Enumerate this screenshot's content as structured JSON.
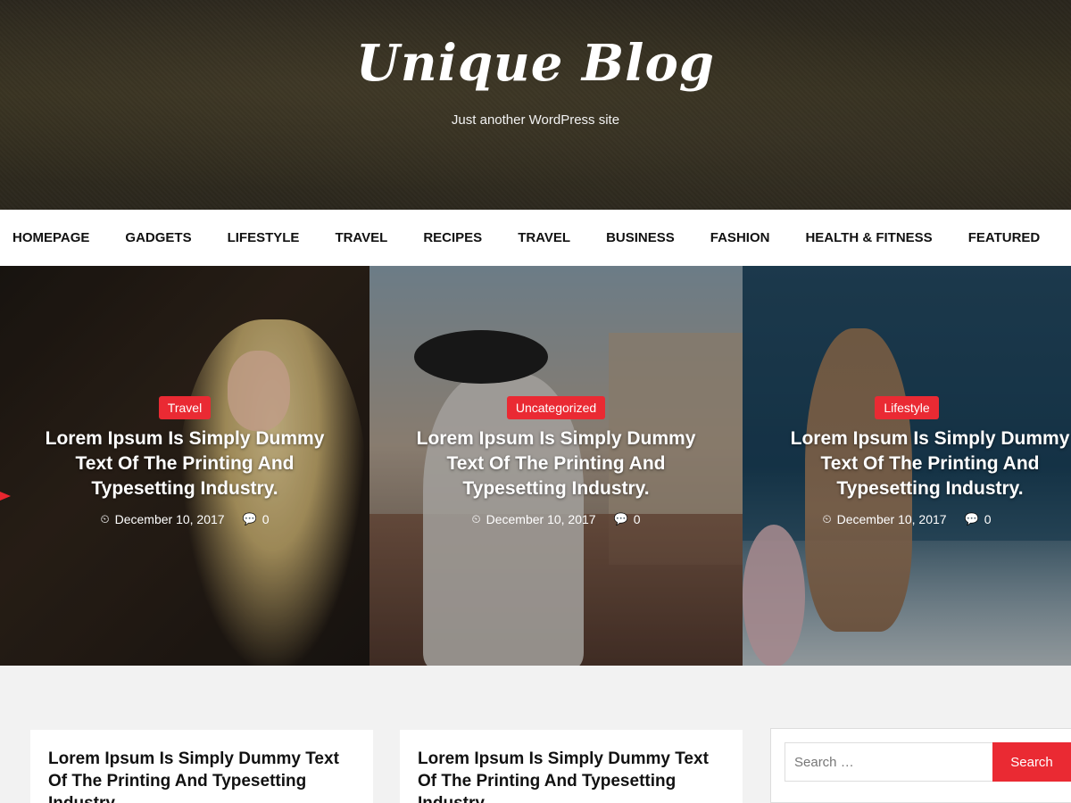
{
  "site": {
    "title": "Unique Blog",
    "tagline": "Just another WordPress site"
  },
  "nav": {
    "items": [
      "HOMEPAGE",
      "GADGETS",
      "LIFESTYLE",
      "TRAVEL",
      "RECIPES",
      "TRAVEL",
      "BUSINESS",
      "FASHION",
      "HEALTH & FITNESS",
      "FEATURED"
    ]
  },
  "slider": {
    "slides": [
      {
        "category": "Travel",
        "title": "Lorem Ipsum Is Simply Dummy Text Of The Printing And Typesetting Industry.",
        "date": "December 10, 2017",
        "comments": "0"
      },
      {
        "category": "Uncategorized",
        "title": "Lorem Ipsum Is Simply Dummy Text Of The Printing And Typesetting Industry.",
        "date": "December 10, 2017",
        "comments": "0"
      },
      {
        "category": "Lifestyle",
        "title": "Lorem Ipsum Is Simply Dummy Text Of The Printing And Typesetting Industry.",
        "date": "December 10, 2017",
        "comments": "0"
      }
    ]
  },
  "posts": [
    {
      "title": "Lorem Ipsum Is Simply Dummy Text Of The Printing And Typesetting Industry."
    },
    {
      "title": "Lorem Ipsum Is Simply Dummy Text Of The Printing And Typesetting Industry."
    }
  ],
  "sidebar": {
    "search": {
      "placeholder": "Search …",
      "button_label": "Search"
    }
  },
  "colors": {
    "accent": "#ea2a33",
    "header_bg": "#2f2a1f",
    "nav_bg": "#ffffff",
    "content_bg": "#f2f2f2"
  },
  "icons": {
    "date": "clock-icon",
    "comments": "comments-icon"
  }
}
